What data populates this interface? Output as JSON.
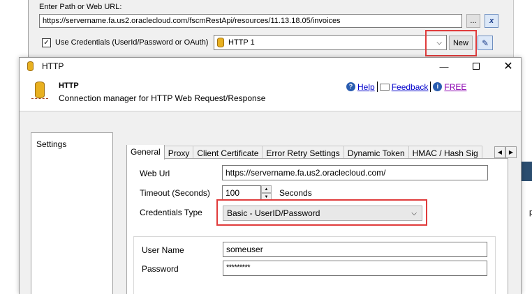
{
  "parent": {
    "url_label": "Enter Path or Web URL:",
    "url_value": "https://servername.fa.us2.oraclecloud.com/fscmRestApi/resources/11.13.18.05/invoices",
    "browse_label": "...",
    "clear_label": "x",
    "use_credentials_label": "Use Credentials (UserId/Password or OAuth)",
    "use_credentials_checked": true,
    "connection_value": "HTTP 1",
    "new_button_label": "New",
    "right_fragment": "pre"
  },
  "dialog": {
    "title": "HTTP",
    "header_title": "HTTP",
    "header_subtitle": "Connection manager for HTTP Web Request/Response",
    "links": {
      "help": "Help",
      "feedback": "Feedback",
      "free": "FREE"
    },
    "sidebar_item": "Settings",
    "tabs": [
      "General",
      "Proxy",
      "Client Certificate",
      "Error Retry Settings",
      "Dynamic Token",
      "HMAC / Hash Sig"
    ],
    "general": {
      "web_url_label": "Web Url",
      "web_url_value": "https://servername.fa.us2.oraclecloud.com/",
      "timeout_label": "Timeout (Seconds)",
      "timeout_value": "100",
      "timeout_unit": "Seconds",
      "credentials_type_label": "Credentials Type",
      "credentials_type_value": "Basic - UserID/Password",
      "user_name_label": "User Name",
      "user_name_value": "someuser",
      "password_label": "Password",
      "password_value": "*********"
    }
  },
  "colors": {
    "highlight": "#e03c3c",
    "link": "#0000cc",
    "help_icon": "#2a5db0"
  }
}
